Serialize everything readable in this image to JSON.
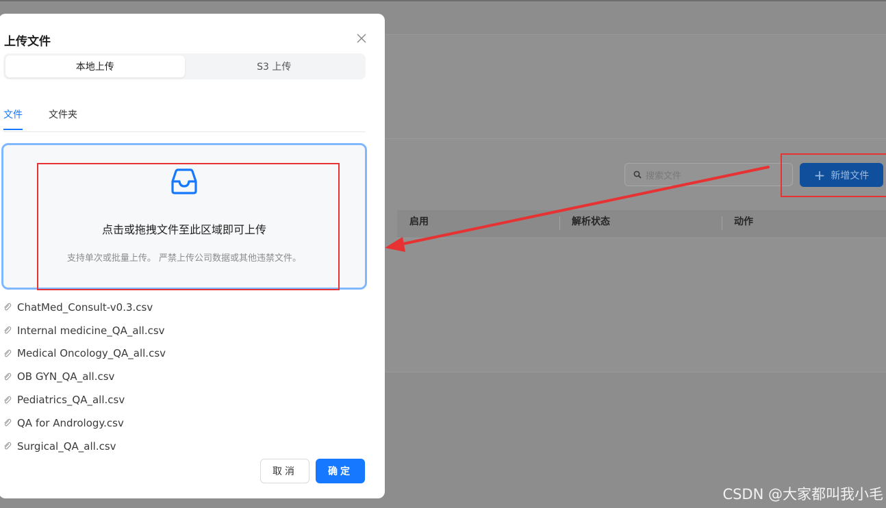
{
  "background": {
    "search_placeholder": "搜索文件",
    "add_button_label": "新增文件",
    "table_headers": [
      "启用",
      "解析状态",
      "动作"
    ]
  },
  "modal": {
    "title": "上传文件",
    "upload_modes": [
      "本地上传",
      "S3 上传"
    ],
    "tabs": [
      "文件",
      "文件夹"
    ],
    "dropzone": {
      "main_text": "点击或拖拽文件至此区域即可上传",
      "hint_text": "支持单次或批量上传。 严禁上传公司数据或其他违禁文件。"
    },
    "files": [
      "ChatMed_Consult-v0.3.csv",
      "Internal medicine_QA_all.csv",
      "Medical Oncology_QA_all.csv",
      "OB GYN_QA_all.csv",
      "Pediatrics_QA_all.csv",
      "QA for Andrology.csv",
      "Surgical_QA_all.csv"
    ],
    "cancel_label": "取消",
    "ok_label": "确定"
  },
  "watermark": "CSDN @大家都叫我小毛",
  "colors": {
    "primary": "#1677ff",
    "annotation_red": "#e63232",
    "dropzone_border": "#7fb8ff"
  }
}
